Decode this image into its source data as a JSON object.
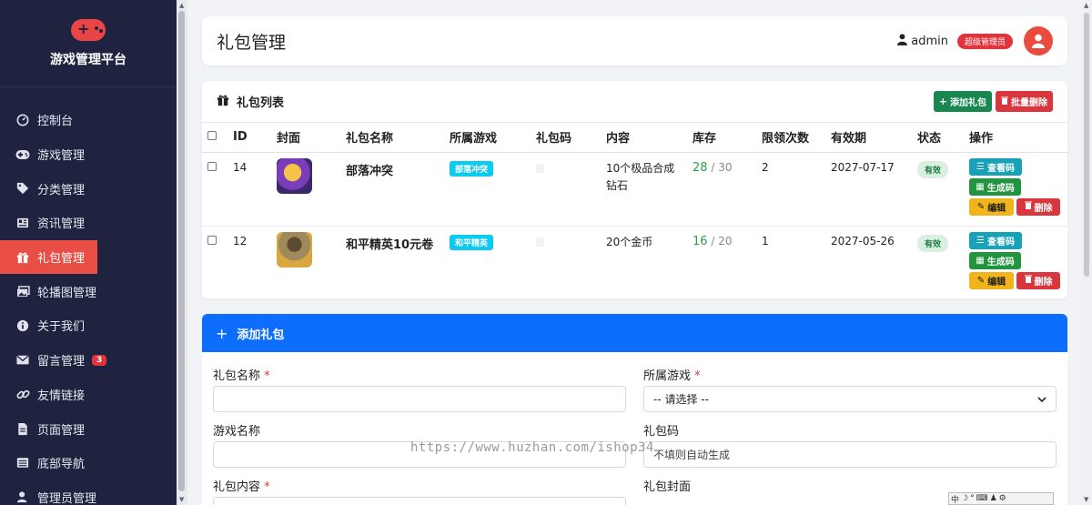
{
  "brand": {
    "title": "游戏管理平台"
  },
  "sidebar": {
    "items": [
      {
        "label": "控制台",
        "icon": "dashboard-icon"
      },
      {
        "label": "游戏管理",
        "icon": "gamepad-icon"
      },
      {
        "label": "分类管理",
        "icon": "tags-icon"
      },
      {
        "label": "资讯管理",
        "icon": "newspaper-icon"
      },
      {
        "label": "礼包管理",
        "icon": "gift-icon",
        "active": true
      },
      {
        "label": "轮播图管理",
        "icon": "images-icon"
      },
      {
        "label": "关于我们",
        "icon": "info-icon"
      },
      {
        "label": "留言管理",
        "icon": "envelope-icon",
        "badge": "3"
      },
      {
        "label": "友情链接",
        "icon": "link-icon"
      },
      {
        "label": "页面管理",
        "icon": "file-icon"
      },
      {
        "label": "底部导航",
        "icon": "table-icon"
      },
      {
        "label": "管理员管理",
        "icon": "user-icon"
      }
    ]
  },
  "header": {
    "title": "礼包管理",
    "username": "admin",
    "role": "超级管理员"
  },
  "list": {
    "title": "礼包列表",
    "add_label": "添加礼包",
    "bulk_delete_label": "批量删除",
    "columns": [
      "ID",
      "封面",
      "礼包名称",
      "所属游戏",
      "礼包码",
      "内容",
      "库存",
      "限领次数",
      "有效期",
      "状态",
      "操作"
    ],
    "rows": [
      {
        "id": "14",
        "name": "部落冲突",
        "game": "部落冲突",
        "content": "10个极品合成钻石",
        "stock_used": "28",
        "stock_total": "/ 30",
        "limit": "2",
        "expiry": "2027-07-17",
        "status": "有效"
      },
      {
        "id": "12",
        "name": "和平精英10元卷",
        "game": "和平精英",
        "content": "20个金币",
        "stock_used": "16",
        "stock_total": "/ 20",
        "limit": "1",
        "expiry": "2027-05-26",
        "status": "有效"
      }
    ],
    "actions": {
      "view": "查看码",
      "generate": "生成码",
      "edit": "编辑",
      "delete": "删除"
    }
  },
  "form": {
    "title": "添加礼包",
    "name_label": "礼包名称",
    "game_label": "所属游戏",
    "game_select": "-- 请选择 --",
    "game_name_label": "游戏名称",
    "code_label": "礼包码",
    "code_value": "不填则自动生成",
    "content_label": "礼包内容",
    "cover_label": "礼包封面",
    "required_mark": "*"
  },
  "watermark": "https://www.huzhan.com/ishop34"
}
